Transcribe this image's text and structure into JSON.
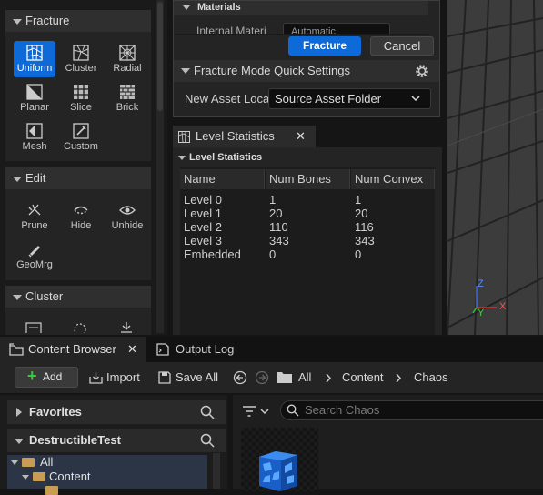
{
  "fracture_panel": {
    "fracture_header": "Fracture",
    "fracture_tools": [
      {
        "label": "Uniform",
        "icon": "uniform-icon",
        "active": true
      },
      {
        "label": "Cluster",
        "icon": "cluster-icon"
      },
      {
        "label": "Radial",
        "icon": "radial-icon"
      },
      {
        "label": "Planar",
        "icon": "planar-icon"
      },
      {
        "label": "Slice",
        "icon": "slice-icon"
      },
      {
        "label": "Brick",
        "icon": "brick-icon"
      },
      {
        "label": "Mesh",
        "icon": "mesh-icon"
      },
      {
        "label": "Custom",
        "icon": "custom-icon"
      }
    ],
    "edit_header": "Edit",
    "edit_tools": [
      {
        "label": "Prune",
        "icon": "prune-icon"
      },
      {
        "label": "Hide",
        "icon": "hide-icon"
      },
      {
        "label": "Unhide",
        "icon": "unhide-icon"
      },
      {
        "label": "GeoMrg",
        "icon": "geo-merge-icon"
      }
    ],
    "cluster_header": "Cluster"
  },
  "dialog": {
    "materials_header": "Materials",
    "internal_material_label": "Internal Materi",
    "internal_material_value": "Automatic",
    "fracture_button": "Fracture",
    "cancel_button": "Cancel",
    "quick_settings_header": "Fracture Mode Quick Settings",
    "new_asset_label": "New Asset Loca",
    "new_asset_value": "Source Asset Folder"
  },
  "level_stats": {
    "tab_label": "Level Statistics",
    "section_header": "Level Statistics",
    "columns": [
      "Name",
      "Num Bones",
      "Num Convex"
    ],
    "rows": [
      [
        "Level 0",
        "1",
        "1"
      ],
      [
        "Level 1",
        "20",
        "20"
      ],
      [
        "Level 2",
        "110",
        "116"
      ],
      [
        "Level 3",
        "343",
        "343"
      ],
      [
        "Embedded",
        "0",
        "0"
      ]
    ]
  },
  "viewport": {
    "axis_z": "Z",
    "axis_x": "X",
    "axis_y": "Y"
  },
  "content_browser": {
    "tab_label": "Content Browser",
    "output_log_tab": "Output Log",
    "add_button": "Add",
    "import_button": "Import",
    "save_all_button": "Save All",
    "breadcrumb": [
      "All",
      "Content",
      "Chaos"
    ],
    "favorites_header": "Favorites",
    "project_header": "DestructibleTest",
    "tree": [
      "All",
      "Content"
    ],
    "search_placeholder": "Search Chaos"
  },
  "colors": {
    "accent": "#0d6ad8",
    "folder": "#c89c52",
    "panel": "#242424"
  }
}
